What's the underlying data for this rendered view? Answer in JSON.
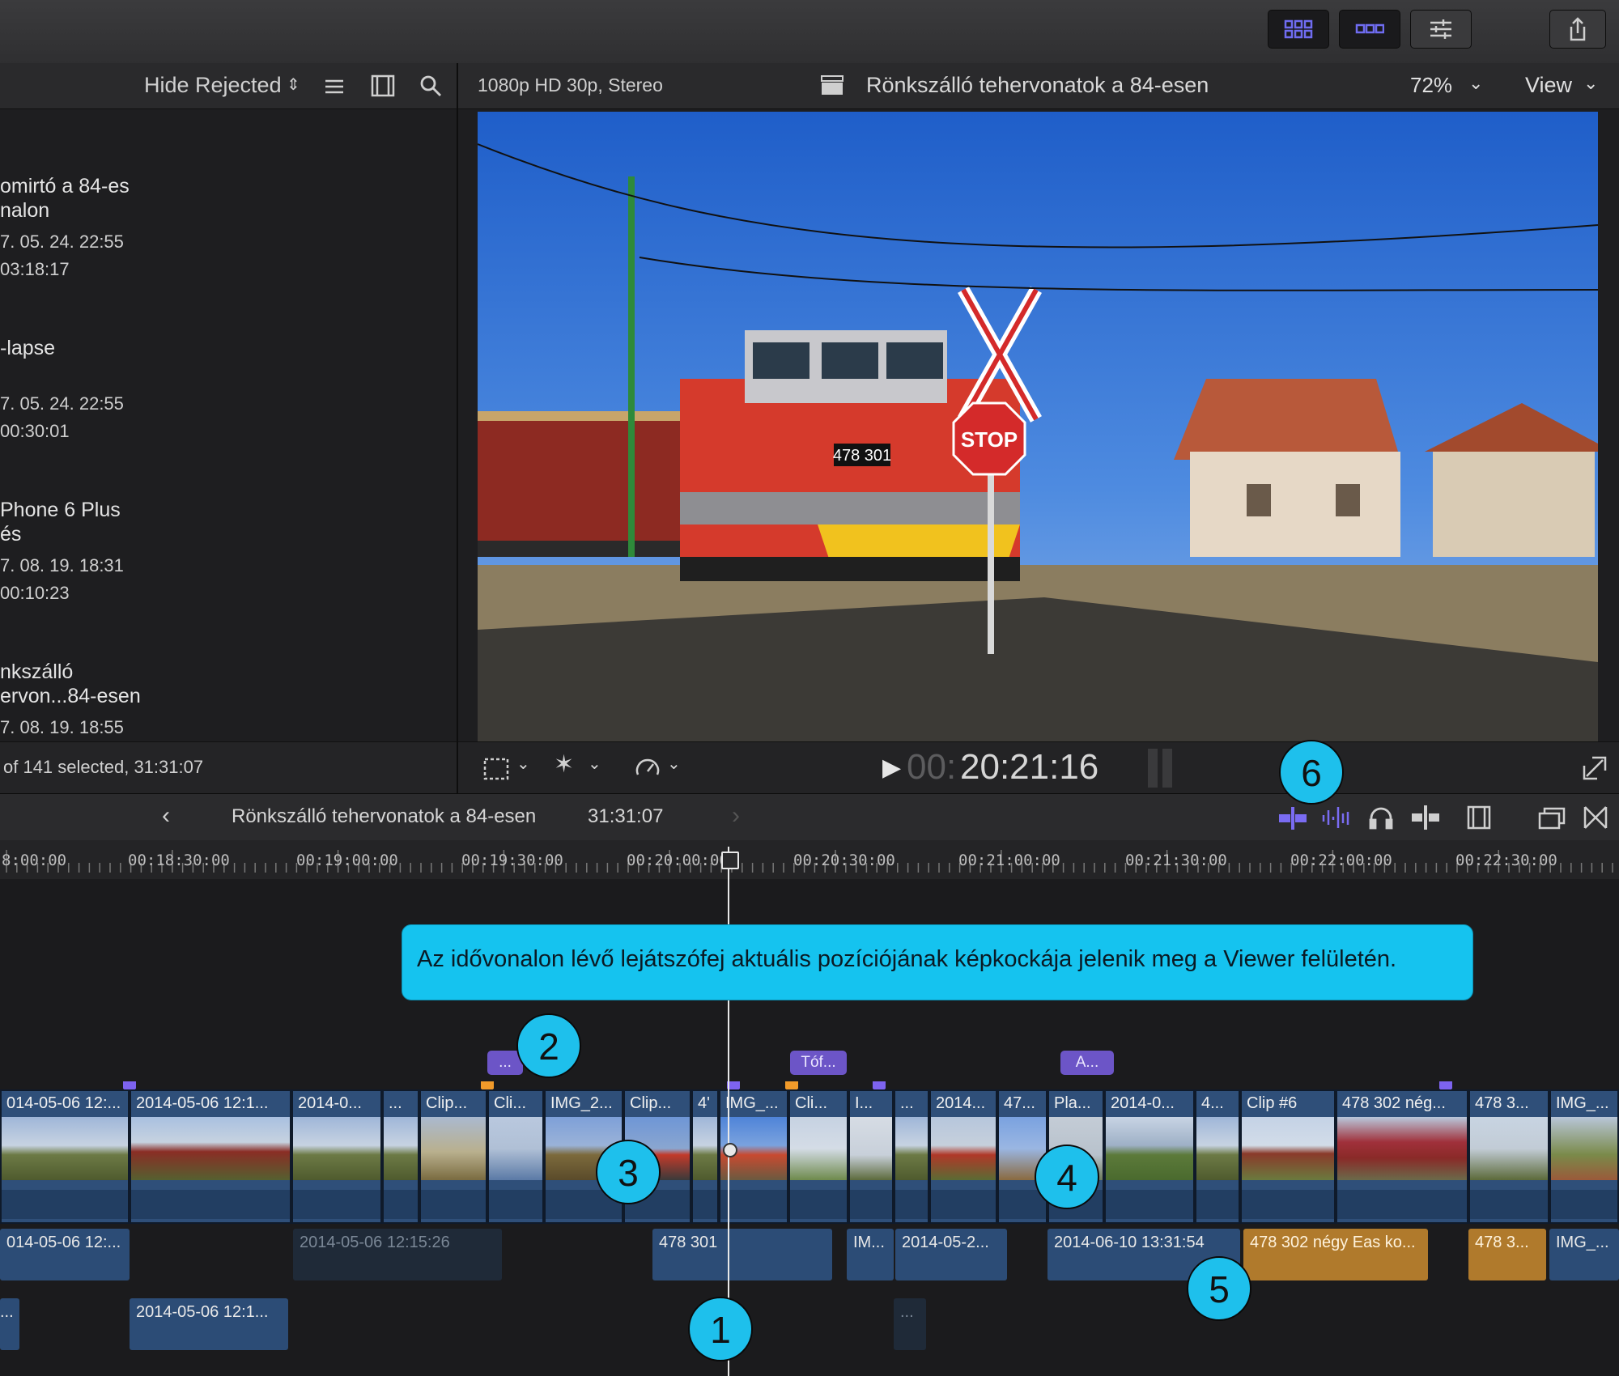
{
  "browser": {
    "filter_label": "Hide Rejected",
    "items": [
      {
        "title1": "omirtó a 84-es",
        "title2": "nalon",
        "date": "7. 05. 24. 22:55",
        "duration": "03:18:17"
      },
      {
        "title1": "-lapse",
        "title2": "",
        "date": "7. 05. 24. 22:55",
        "duration": "00:30:01"
      },
      {
        "title1": "Phone 6 Plus",
        "title2": "és",
        "date": "7. 08. 19. 18:31",
        "duration": "00:10:23"
      },
      {
        "title1": "nkszálló",
        "title2": "ervon...84-esen",
        "date": "7. 08. 19. 18:55",
        "duration": ""
      }
    ],
    "footer": "of 141 selected, 31:31:07"
  },
  "viewer": {
    "format": "1080p HD 30p, Stereo",
    "title": "Rönkszálló tehervonatok a 84-esen",
    "zoom": "72%",
    "view_label": "View",
    "timecode_dim": "00:",
    "timecode": "20:21:16"
  },
  "image_text": {
    "loco_number": "478 301",
    "stop_sign": "STOP"
  },
  "timeline": {
    "project": "Rönkszálló tehervonatok a 84-esen",
    "duration": "31:31:07",
    "ruler": [
      "8:00:00",
      "00:18:30:00",
      "00:19:00:00",
      "00:19:30:00",
      "00:20:00:00",
      "00:20:30:00",
      "00:21:00:00",
      "00:21:30:00",
      "00:22:00:00",
      "00:22:30:00"
    ],
    "primary_clips": [
      "014-05-06 12:...",
      "2014-05-06 12:1...",
      "2014-0...",
      "...",
      "Clip...",
      "Cli...",
      "IMG_2...",
      "Clip...",
      "4'",
      "IMG_...",
      "Cli...",
      "I...",
      "...",
      "2014...",
      "47...",
      "Pla...",
      "2014-0...",
      "4...",
      "Clip #6",
      "478 302 nég...",
      "478 3...",
      "IMG_..."
    ],
    "tags": [
      "...",
      "Tóf...",
      "A..."
    ],
    "connected_row1": [
      "014-05-06 12:...",
      "2014-05-06 12:15:26",
      "478 301",
      "IM...",
      "2014-05-2...",
      "2014-06-10 13:31:54",
      "478 302 négy Eas ko...",
      "478 3...",
      "IMG_..."
    ],
    "connected_row2": [
      "...",
      "2014-05-06 12:1...",
      "..."
    ]
  },
  "callout": "Az idővonalon lévő lejátszófej aktuális pozíciójának képkockája jelenik meg a Viewer felületén.",
  "badges": [
    "1",
    "2",
    "3",
    "4",
    "5",
    "6"
  ],
  "colors": {
    "accent": "#1ec0ec",
    "clip_blue": "#2f4f79",
    "clip_orange": "#b07a2c",
    "marker": "#6c55c7"
  }
}
